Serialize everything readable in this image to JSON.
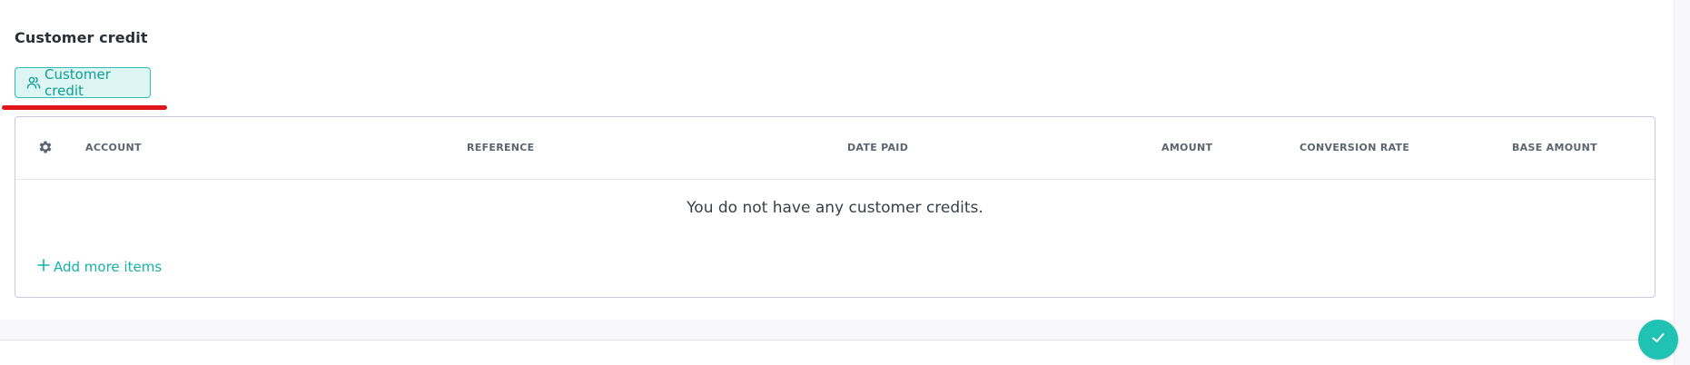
{
  "section": {
    "title": "Customer credit"
  },
  "tab_button": {
    "label": "Customer credit",
    "icon": "users-icon"
  },
  "table": {
    "settings_icon": "gear-icon",
    "columns": [
      "ACCOUNT",
      "REFERENCE",
      "DATE PAID",
      "AMOUNT",
      "CONVERSION RATE",
      "BASE AMOUNT"
    ],
    "empty_message": "You do not have any customer credits.",
    "add_label": "Add more items",
    "add_icon": "plus-icon"
  },
  "fab": {
    "icon": "check-icon"
  },
  "colors": {
    "accent": "#20c2b4",
    "accent_text": "#0f9f94",
    "accent_bg": "#ddf5f3",
    "highlight": "#e0141b"
  }
}
